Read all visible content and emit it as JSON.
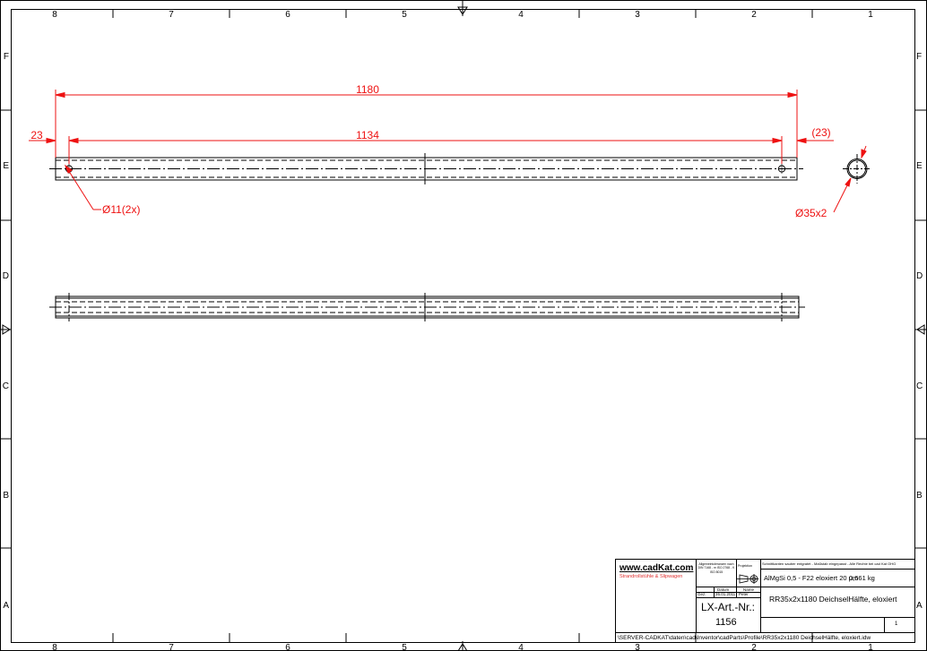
{
  "frame": {
    "columns": [
      "8",
      "7",
      "6",
      "5",
      "4",
      "3",
      "2",
      "1"
    ],
    "rows": [
      "F",
      "E",
      "D",
      "C",
      "B",
      "A"
    ]
  },
  "dimensions": {
    "overall_length": "1180",
    "hole_spacing": "1134",
    "left_offset": "23",
    "right_offset": "(23)",
    "hole_callout": "Ø11(2x)",
    "section_callout": "Ø35x2"
  },
  "title_block": {
    "company_site": "www.cadKat.com",
    "company_tagline": "Strandrollstühle & Slipwagen",
    "general_tol_note": "Allgemeintoleranzen nach DIN 7168 - m ISO 2768 - K ISO 8015",
    "projection_label": "Projektion",
    "top_note": "Schnittkanten sauber entgratet - Maßstab eingepasst - Alle Rechte bei cad Kat OHG",
    "material": "AlMgSi 0,5 - F22 eloxiert 20 µm",
    "mass": "0,661 kg",
    "date_header": "Datum",
    "name_header": "Name",
    "row_label": "Gez.",
    "date": "26.01.2011",
    "drawn_by": "Peter",
    "art_nr_label": "LX-Art.-Nr.:",
    "art_nr": "1156",
    "title": "RR35x2x1180 DeichselHälfte, eloxiert",
    "sheet": "1",
    "file_path": "\\SERVER-CADKAT\\daten\\cad\\Inventor\\cadParts\\Profile\\RR35x2x1180 DeichselHälfte, eloxiert.idw"
  },
  "colors": {
    "dimension": "#ee1111",
    "line": "#000000",
    "brand": "#e03030"
  }
}
